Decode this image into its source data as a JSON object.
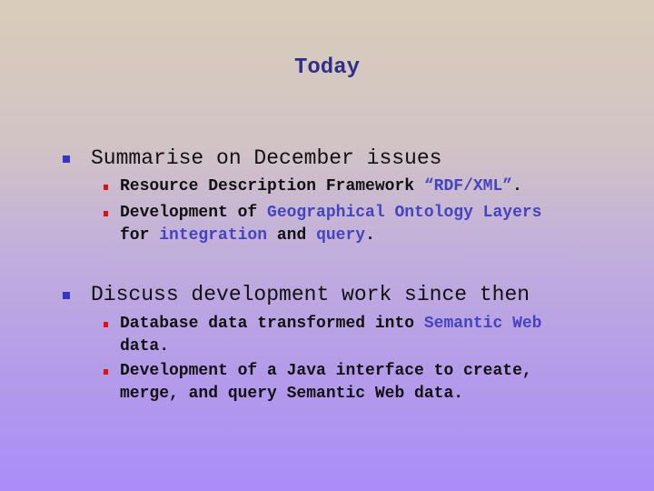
{
  "slide": {
    "title": "Today",
    "colors": {
      "title": "#2e2e8c",
      "level1_bullet": "#3636c4",
      "level2_bullet": "#e01010",
      "highlight": "#4444c0",
      "background_top": "#d9cdb9",
      "background_bottom": "#ab8cf9"
    },
    "bullets": [
      {
        "text": "Summarise on December issues",
        "children": [
          {
            "parts": [
              {
                "text": "Resource Description Framework ",
                "highlight": false
              },
              {
                "text": "“RDF/XML”",
                "highlight": true
              },
              {
                "text": ".",
                "highlight": false
              }
            ]
          },
          {
            "line1": [
              {
                "text": "Development of ",
                "highlight": false
              },
              {
                "text": "Geographical Ontology Layers",
                "highlight": true
              }
            ],
            "line2": [
              {
                "text": "for ",
                "highlight": false
              },
              {
                "text": "integration",
                "highlight": true
              },
              {
                "text": " and ",
                "highlight": false
              },
              {
                "text": "query",
                "highlight": true
              },
              {
                "text": ".",
                "highlight": false
              }
            ]
          }
        ]
      },
      {
        "text": "Discuss development work since then",
        "children": [
          {
            "line1": [
              {
                "text": "Database data transformed into ",
                "highlight": false
              },
              {
                "text": "Semantic Web",
                "highlight": true
              }
            ],
            "line2": "data."
          },
          {
            "line1": "Development of a Java interface to create,",
            "line2": "merge, and query Semantic Web data."
          }
        ]
      }
    ]
  }
}
